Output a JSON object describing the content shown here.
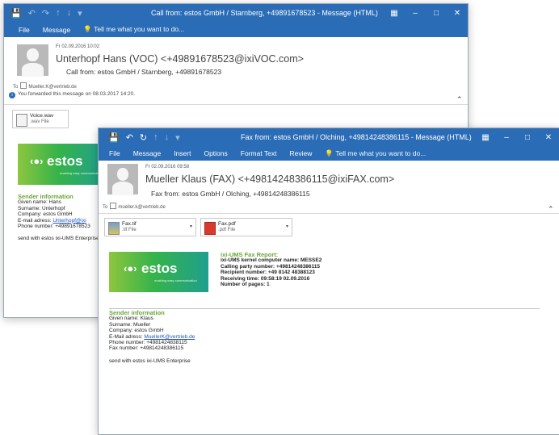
{
  "back": {
    "title": "Call from: estos GmbH / Starnberg, +49891678523 - Message (HTML)",
    "tabs": [
      "File",
      "Message"
    ],
    "tell_me": "Tell me what you want to do...",
    "date": "Fr 02.09.2016 10:02",
    "from": "Unterhopf Hans (VOC) <+49891678523@ixiVOC.com>",
    "subject": "Call from: estos GmbH / Starnberg, +49891678523",
    "to_label": "To",
    "to": "Mueller.K@vertrieb.de",
    "info": "You forwarded this message on 08.03.2017 14:20.",
    "attachment": {
      "name": "Voice.wav",
      "size": ".wav File"
    },
    "logo": "estos",
    "logo_tag": "enabling easy communication",
    "sig": {
      "heading": "Sender information",
      "given": "Given name: Hans",
      "surname": "Surname: Unterhopf",
      "company": "Company: estos GmbH",
      "email_label": "E-mail adress: ",
      "email_link": "Unterhopf@ixi",
      "phone": "Phone number: +49891678523",
      "footer": "send with estos ixi-UMS Enterprise"
    }
  },
  "front": {
    "title": "Fax from: estos GmbH / Olching, +49814248386115 - Message (HTML)",
    "tabs": [
      "File",
      "Message",
      "Insert",
      "Options",
      "Format Text",
      "Review"
    ],
    "tell_me": "Tell me what you want to do...",
    "date": "Fr 02.09.2016 09:58",
    "from": "Mueller Klaus (FAX) <+49814248386115@ixiFAX.com>",
    "subject": "Fax from: estos GmbH / Olching, +49814248386115",
    "to_label": "To",
    "to": "mueller.k@vertrieb.de",
    "attachments": [
      {
        "name": "Fax.tif",
        "size": ".tif File"
      },
      {
        "name": "Fax.pdf",
        "size": ".pdf File"
      }
    ],
    "logo": "estos",
    "logo_tag": "enabling easy communication",
    "report": {
      "heading": "ixi-UMS Fax Report:",
      "lines": [
        "ixi-UMS kernel computer name: MESSE2",
        "Calling party number: +49814248386115",
        "Recipient number: +49 8142 48388123",
        "Receiving time: 09:58:19 02.09.2016",
        "Number of pages: 1"
      ]
    },
    "sig": {
      "heading": "Sender information",
      "given": "Given name: Klaus",
      "surname": "Surname: Mueller",
      "company": "Company: estos GmbH",
      "email_label": "E-Mail adress: ",
      "email_link": "MuellerK@vertrieb.de",
      "phone": "Phone number: +4981424838115",
      "fax": "Fax number: +49814248386115",
      "footer": "send with estos ixi-UMS Enterprise"
    }
  }
}
